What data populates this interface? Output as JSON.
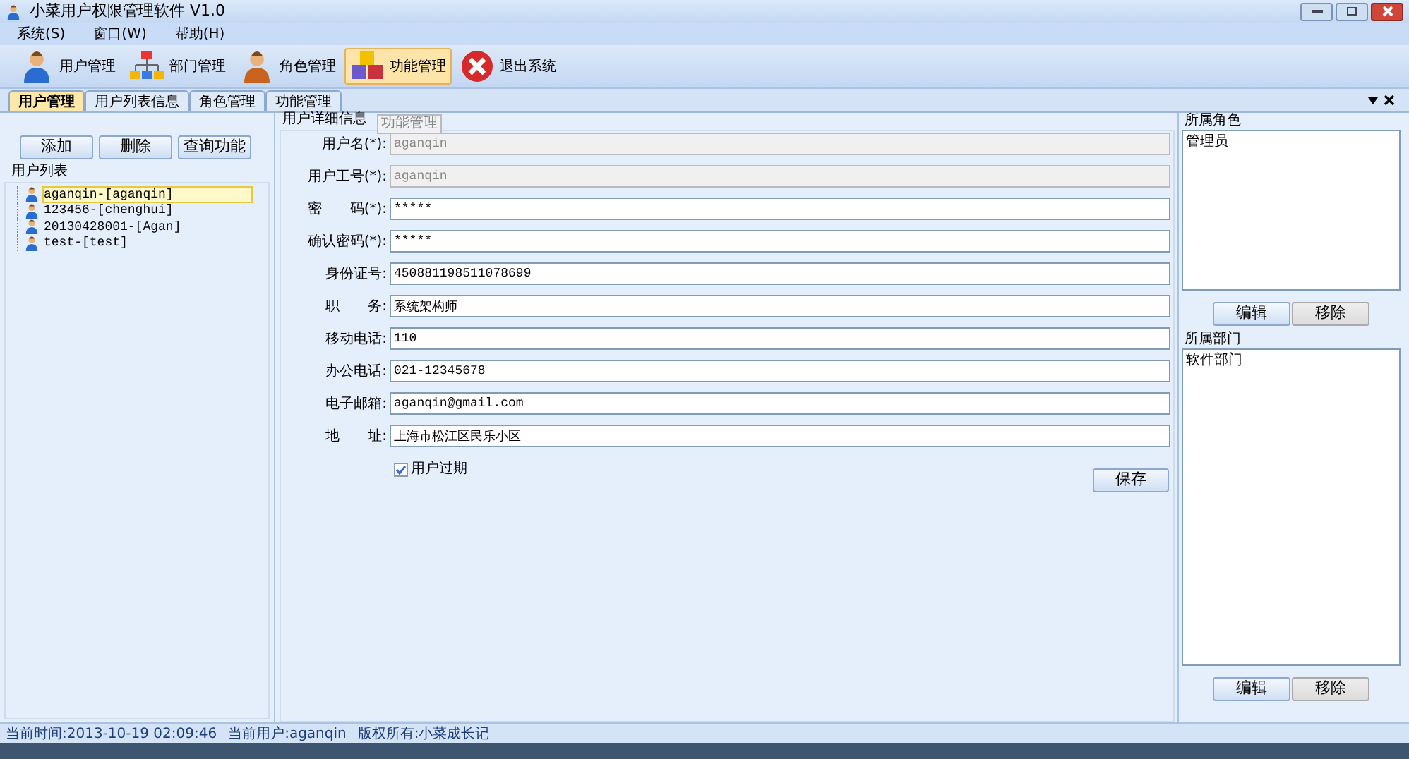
{
  "window": {
    "title": "小菜用户权限管理软件 V1.0"
  },
  "menu": [
    "系统(S)",
    "窗口(W)",
    "帮助(H)"
  ],
  "toolbar": [
    {
      "label": "用户管理",
      "kind": "user",
      "selected": false
    },
    {
      "label": "部门管理",
      "kind": "org",
      "selected": false
    },
    {
      "label": "角色管理",
      "kind": "role",
      "selected": false
    },
    {
      "label": "功能管理",
      "kind": "cubes",
      "selected": true
    },
    {
      "label": "退出系统",
      "kind": "exit",
      "selected": false
    }
  ],
  "tabs": [
    {
      "label": "用户管理",
      "selected": true
    },
    {
      "label": "用户列表信息",
      "selected": false
    },
    {
      "label": "角色管理",
      "selected": false
    },
    {
      "label": "功能管理",
      "selected": false
    }
  ],
  "left": {
    "buttons": [
      "添加",
      "删除",
      "查询功能"
    ],
    "list_title": "用户列表",
    "users": [
      {
        "label": "aganqin-[aganqin]",
        "selected": true
      },
      {
        "label": "123456-[chenghui]",
        "selected": false
      },
      {
        "label": "20130428001-[Agan]",
        "selected": false
      },
      {
        "label": "test-[test]",
        "selected": false
      }
    ]
  },
  "details": {
    "title": "用户详细信息",
    "drag_tooltip": "功能管理",
    "fields": [
      {
        "label": "用户名(*):",
        "value": "aganqin",
        "disabled": true
      },
      {
        "label": "用户工号(*):",
        "value": "aganqin",
        "disabled": true
      },
      {
        "label": "密　　码(*):",
        "value": "*****",
        "disabled": false
      },
      {
        "label": "确认密码(*):",
        "value": "*****",
        "disabled": false
      },
      {
        "label": "身份证号:",
        "value": "450881198511078699",
        "disabled": false
      },
      {
        "label": "职　　务:",
        "value": "系统架构师",
        "disabled": false
      },
      {
        "label": "移动电话:",
        "value": "110",
        "disabled": false
      },
      {
        "label": "办公电话:",
        "value": "021-12345678",
        "disabled": false
      },
      {
        "label": "电子邮箱:",
        "value": "aganqin@gmail.com",
        "disabled": false
      },
      {
        "label": "地　　址:",
        "value": "上海市松江区民乐小区",
        "disabled": false
      }
    ],
    "expired": {
      "label": "用户过期",
      "checked": true
    },
    "save": "保存"
  },
  "roles": {
    "title": "所属角色",
    "items": [
      "管理员"
    ],
    "buttons": [
      {
        "label": "编辑",
        "disabled": false
      },
      {
        "label": "移除",
        "disabled": true
      }
    ]
  },
  "departments": {
    "title": "所属部门",
    "items": [
      "软件部门"
    ],
    "buttons": [
      {
        "label": "编辑",
        "disabled": false
      },
      {
        "label": "移除",
        "disabled": true
      }
    ]
  },
  "status_bar": [
    "当前时间:2013-10-19 02:09:46",
    "当前用户:aganqin",
    "版权所有:小菜成长记"
  ]
}
